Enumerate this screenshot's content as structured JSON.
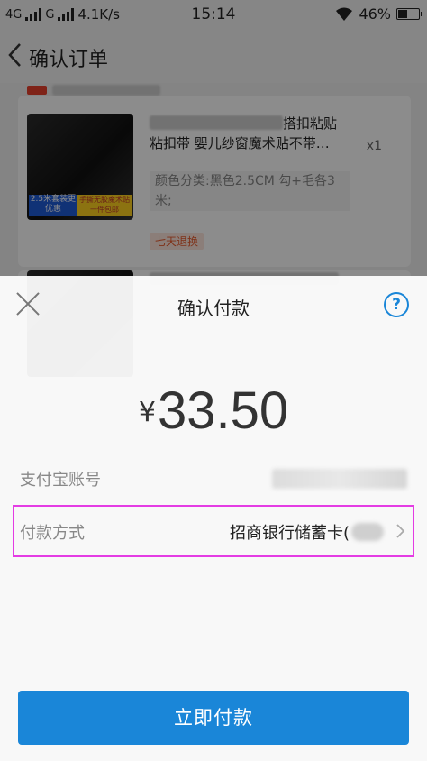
{
  "status_bar": {
    "network_1": "4G",
    "network_2": "G",
    "speed": "4.1K/s",
    "time": "15:14",
    "battery": "46%",
    "battery_level": 0.46
  },
  "order_page": {
    "title": "确认订单",
    "product_1": {
      "title_visible": "搭扣粘贴",
      "title_line2": "粘扣带 婴儿纱窗魔术贴不带…",
      "spec": "颜色分类:黑色2.5CM 勾+毛各3米;",
      "qty": "x1",
      "img_tag_left": "2.5米套装更优惠",
      "img_tag_right": "手撕无胶魔术贴一件包邮",
      "return_policy": "七天退换"
    }
  },
  "payment_sheet": {
    "title": "确认付款",
    "help_label": "?",
    "currency_symbol": "¥",
    "amount": "33.50",
    "account_label": "支付宝账号",
    "method_label": "付款方式",
    "method_value": "招商银行储蓄卡(",
    "pay_button": "立即付款"
  },
  "colors": {
    "accent": "#1a86d8",
    "highlight_border": "#e43ce4",
    "return_tag": "#e85a2c"
  }
}
